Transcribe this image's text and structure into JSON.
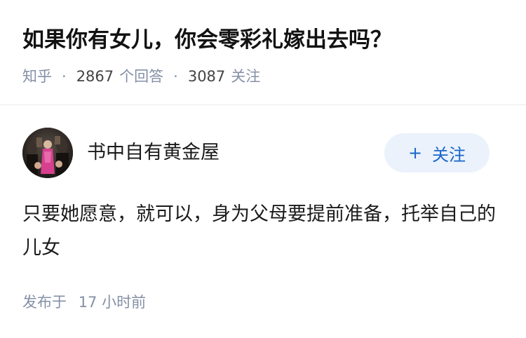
{
  "question": {
    "title": "如果你有女儿，你会零彩礼嫁出去吗？",
    "source": "知乎",
    "answers_count": "2867",
    "answers_label": "个回答",
    "followers_count": "3087",
    "followers_label": "关注"
  },
  "answer": {
    "author": {
      "name": "书中自有黄金屋",
      "avatar_icon": "avatar-photo"
    },
    "follow_button": {
      "icon": "plus-icon",
      "plus": "+",
      "label": "关注"
    },
    "content": "只要她愿意，就可以，身为父母要提前准备，托举自己的儿女",
    "posted_prefix": "发布于",
    "posted_time": "17 小时前"
  },
  "colors": {
    "meta_gray": "#8590a6",
    "follow_bg": "#ebf2fc",
    "follow_text": "#1766c9"
  }
}
